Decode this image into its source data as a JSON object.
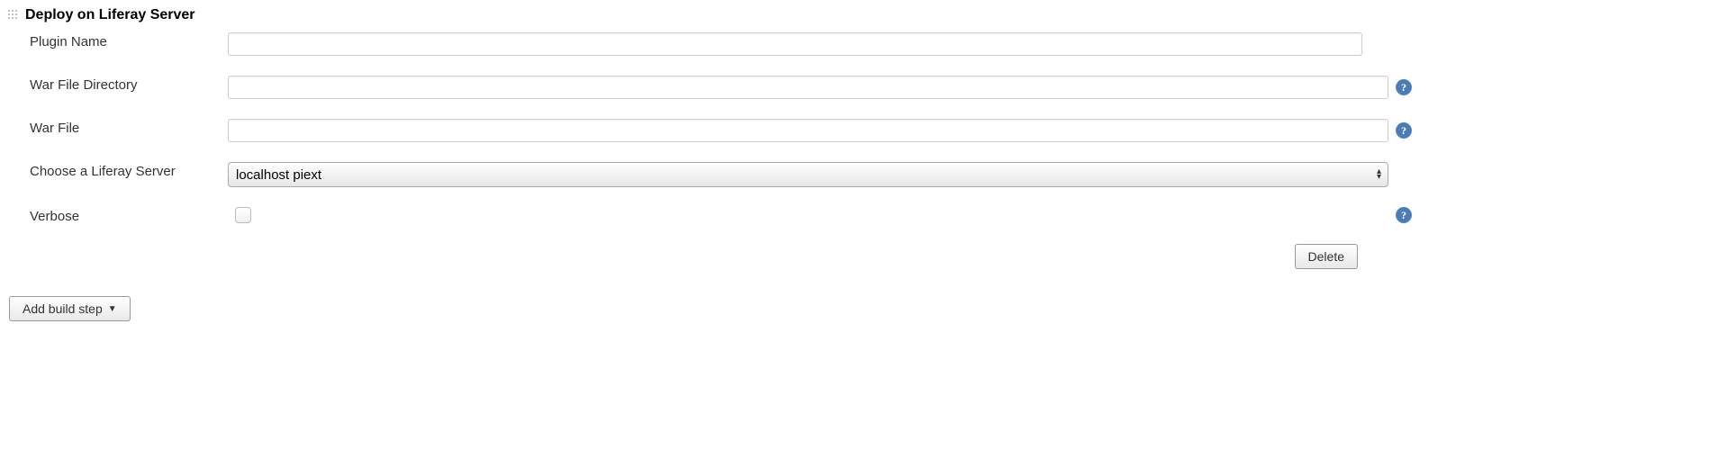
{
  "section": {
    "title": "Deploy on Liferay Server"
  },
  "fields": {
    "pluginName": {
      "label": "Plugin Name",
      "value": ""
    },
    "warFileDirectory": {
      "label": "War File Directory",
      "value": ""
    },
    "warFile": {
      "label": "War File",
      "value": ""
    },
    "liferayServer": {
      "label": "Choose a Liferay Server",
      "selected": "localhost piext",
      "options": [
        "localhost piext"
      ]
    },
    "verbose": {
      "label": "Verbose",
      "checked": false
    }
  },
  "buttons": {
    "delete": "Delete",
    "addBuildStep": "Add build step"
  }
}
